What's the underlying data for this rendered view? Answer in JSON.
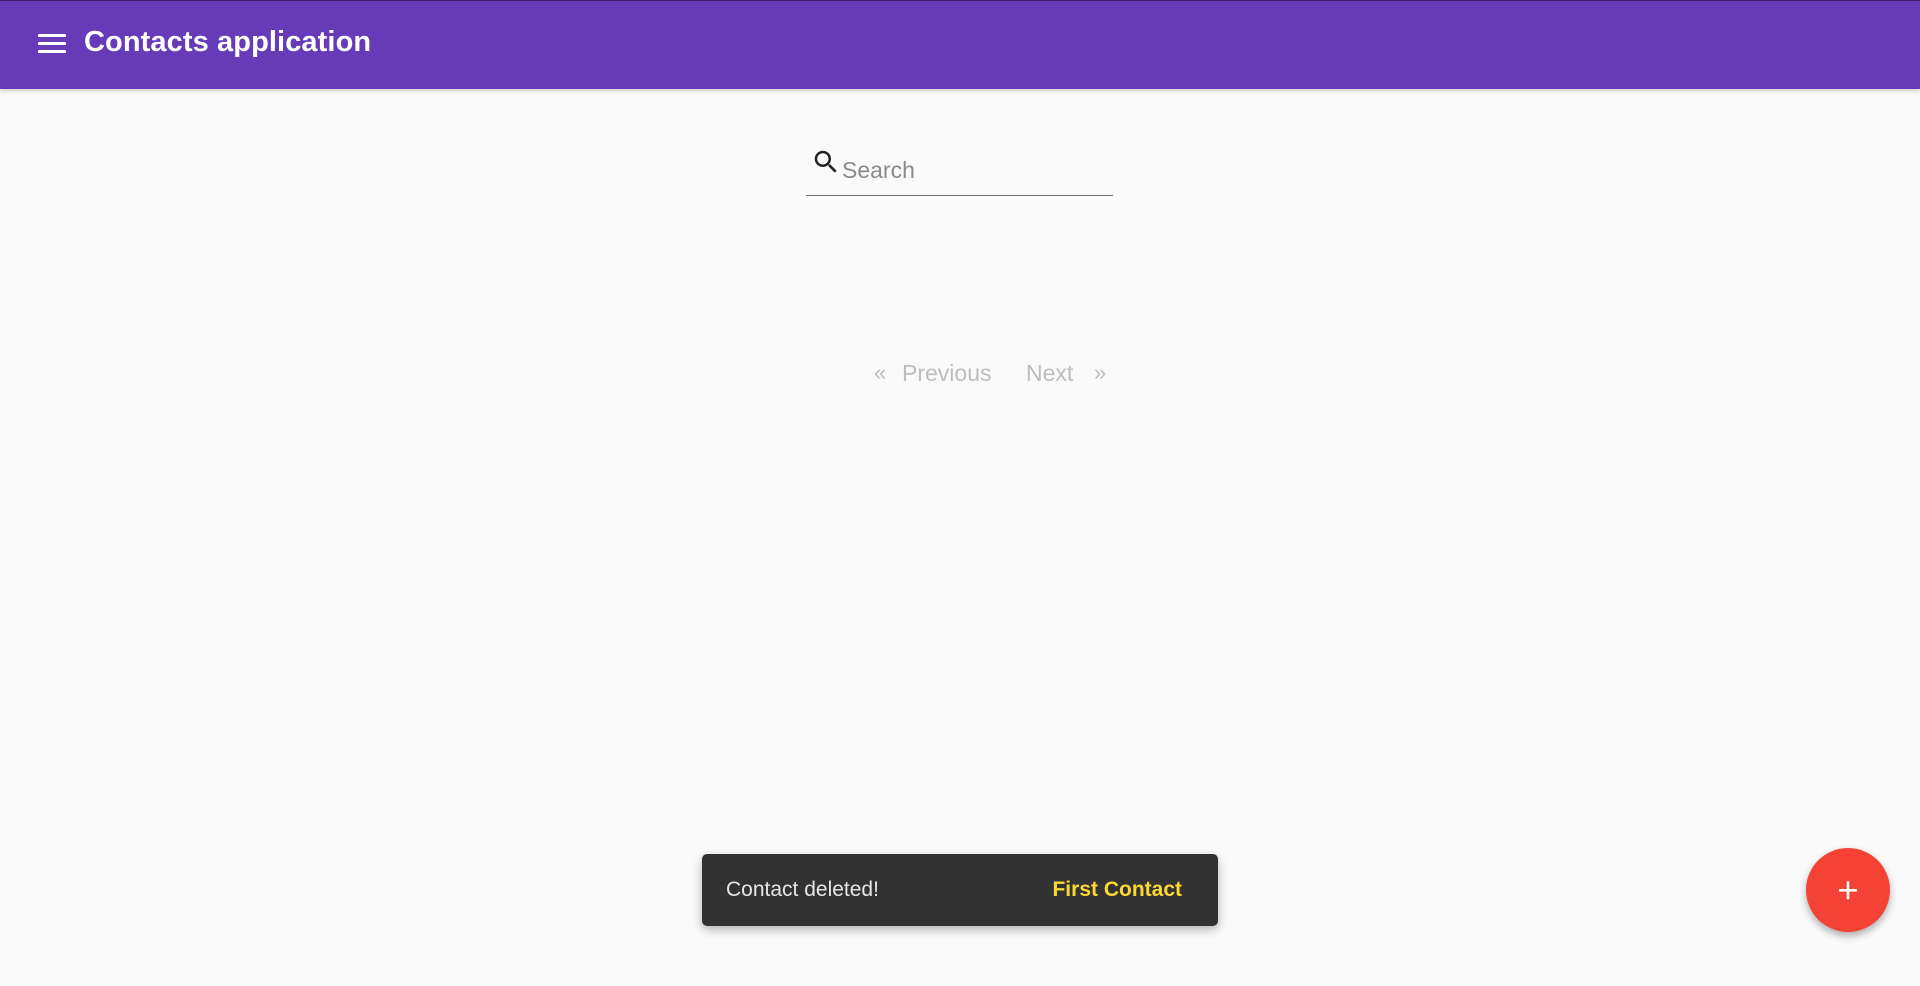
{
  "app_bar": {
    "title": "Contacts application",
    "menu_icon": "menu-icon",
    "color": "#673ab7"
  },
  "search": {
    "placeholder": "Search",
    "value": "",
    "icon": "search-icon"
  },
  "pagination": {
    "prev_arrow": "«",
    "prev_label": "Previous",
    "next_label": "Next",
    "next_arrow": "»",
    "disabled_color": "#bdbdbd"
  },
  "snackbar": {
    "message": "Contact deleted!",
    "action_label": "First Contact",
    "action_color": "#fdd835"
  },
  "fab": {
    "icon": "plus-icon",
    "color": "#f44336"
  }
}
